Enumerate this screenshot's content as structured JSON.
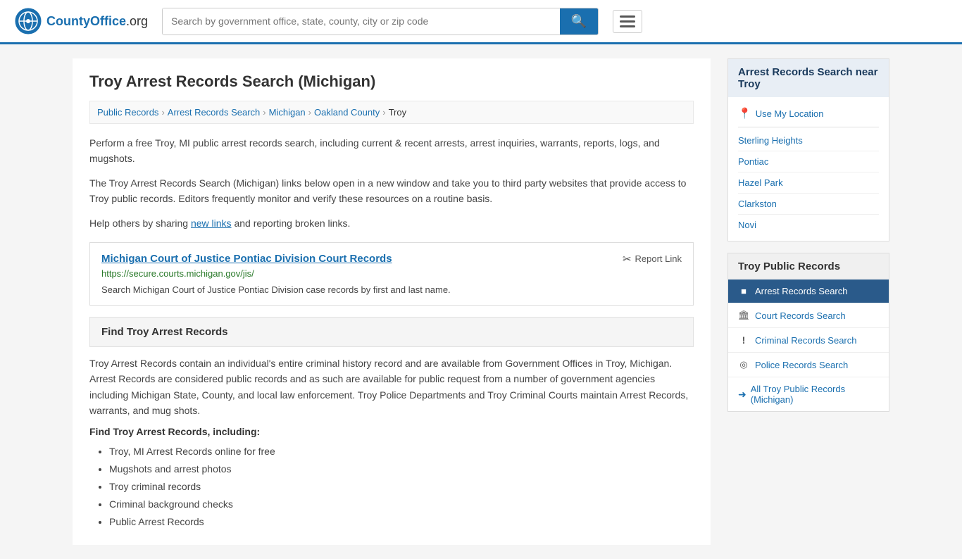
{
  "header": {
    "logo_text": "CountyOffice",
    "logo_suffix": ".org",
    "search_placeholder": "Search by government office, state, county, city or zip code",
    "menu_label": "Menu"
  },
  "page": {
    "title": "Troy Arrest Records Search (Michigan)"
  },
  "breadcrumb": {
    "items": [
      {
        "label": "Public Records",
        "href": "#"
      },
      {
        "label": "Arrest Records Search",
        "href": "#"
      },
      {
        "label": "Michigan",
        "href": "#"
      },
      {
        "label": "Oakland County",
        "href": "#"
      },
      {
        "label": "Troy",
        "href": "#"
      }
    ]
  },
  "intro": {
    "paragraph1": "Perform a free Troy, MI public arrest records search, including current & recent arrests, arrest inquiries, warrants, reports, logs, and mugshots.",
    "paragraph2": "The Troy Arrest Records Search (Michigan) links below open in a new window and take you to third party websites that provide access to Troy public records. Editors frequently monitor and verify these resources on a routine basis.",
    "paragraph3_prefix": "Help others by sharing ",
    "paragraph3_link": "new links",
    "paragraph3_suffix": " and reporting broken links."
  },
  "record": {
    "title": "Michigan Court of Justice Pontiac Division Court Records",
    "url": "https://secure.courts.michigan.gov/jis/",
    "description": "Search Michigan Court of Justice Pontiac Division case records by first and last name.",
    "report_label": "Report Link"
  },
  "find_section": {
    "title": "Find Troy Arrest Records",
    "body_text": "Troy Arrest Records contain an individual's entire criminal history record and are available from Government Offices in Troy, Michigan. Arrest Records are considered public records and as such are available for public request from a number of government agencies including Michigan State, County, and local law enforcement. Troy Police Departments and Troy Criminal Courts maintain Arrest Records, warrants, and mug shots.",
    "subtext": "Find Troy Arrest Records, including:",
    "bullets": [
      "Troy, MI Arrest Records online for free",
      "Mugshots and arrest photos",
      "Troy criminal records",
      "Criminal background checks",
      "Public Arrest Records"
    ]
  },
  "sidebar": {
    "nearby_title": "Arrest Records Search near Troy",
    "use_my_location": "Use My Location",
    "nearby_locations": [
      "Sterling Heights",
      "Pontiac",
      "Hazel Park",
      "Clarkston",
      "Novi"
    ],
    "public_records_title": "Troy Public Records",
    "nav_items": [
      {
        "label": "Arrest Records Search",
        "icon": "■",
        "active": true
      },
      {
        "label": "Court Records Search",
        "icon": "🏛",
        "active": false
      },
      {
        "label": "Criminal Records Search",
        "icon": "!",
        "active": false
      },
      {
        "label": "Police Records Search",
        "icon": "◎",
        "active": false
      }
    ],
    "all_link": "All Troy Public Records (Michigan)"
  }
}
